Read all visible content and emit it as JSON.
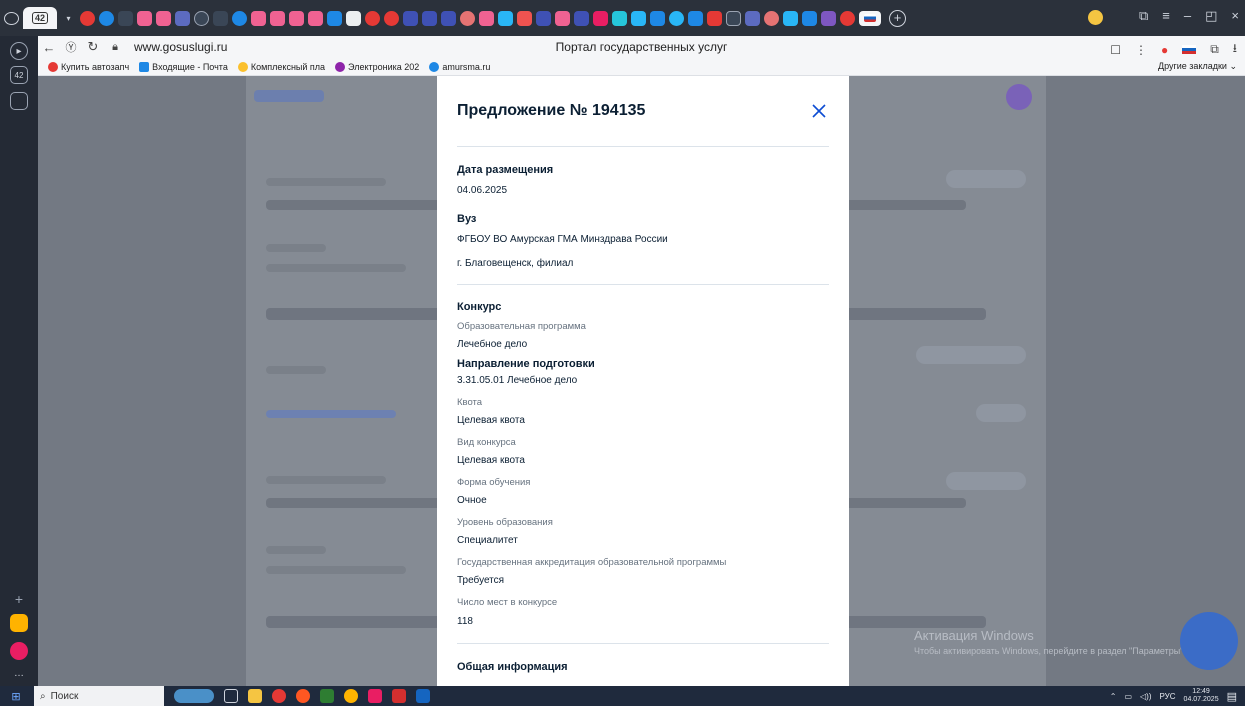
{
  "browser": {
    "tab_count": "42",
    "url": "www.gosuslugi.ru",
    "page_title": "Портал государственных услуг",
    "bookmarks": [
      {
        "label": "Купить автозапч",
        "color": "#e53935"
      },
      {
        "label": "Входящие - Почта",
        "color": "#1e88e5"
      },
      {
        "label": "Комплексный пла",
        "color": "#fbc02d"
      },
      {
        "label": "Электроника 202",
        "color": "#8e24aa"
      },
      {
        "label": "amursma.ru",
        "color": "#1e88e5"
      }
    ],
    "other_bookmarks": "Другие закладки"
  },
  "modal": {
    "title": "Предложение № 194135",
    "date_heading": "Дата размещения",
    "date_value": "04.06.2025",
    "university_heading": "Вуз",
    "university_name": "ФГБОУ ВО Амурская ГМА Минздрава России",
    "university_branch": "г. Благовещенск, филиал",
    "contest_heading": "Конкурс",
    "program_label": "Образовательная программа",
    "program_value": "Лечебное дело",
    "direction_heading": "Направление подготовки",
    "direction_value": "3.31.05.01 Лечебное дело",
    "quota_label": "Квота",
    "quota_value": "Целевая квота",
    "contest_type_label": "Вид конкурса",
    "contest_type_value": "Целевая квота",
    "study_form_label": "Форма обучения",
    "study_form_value": "Очное",
    "edu_level_label": "Уровень образования",
    "edu_level_value": "Специалитет",
    "accreditation_label": "Государственная аккредитация образовательной программы",
    "accreditation_value": "Требуется",
    "places_label": "Число мест в конкурсе",
    "places_value": "118",
    "general_heading": "Общая информация"
  },
  "watermark": {
    "title": "Активация Windows",
    "subtitle": "Чтобы активировать Windows, перейдите в раздел \"Параметры\"."
  },
  "taskbar": {
    "search_placeholder": "Поиск",
    "lang": "РУС",
    "time": "12:49",
    "date": "04.07.2025"
  },
  "colors": {
    "accent": "#0d4cd3",
    "text_primary": "#0b1f33",
    "text_secondary": "#66727f",
    "overlay": "#737983"
  }
}
